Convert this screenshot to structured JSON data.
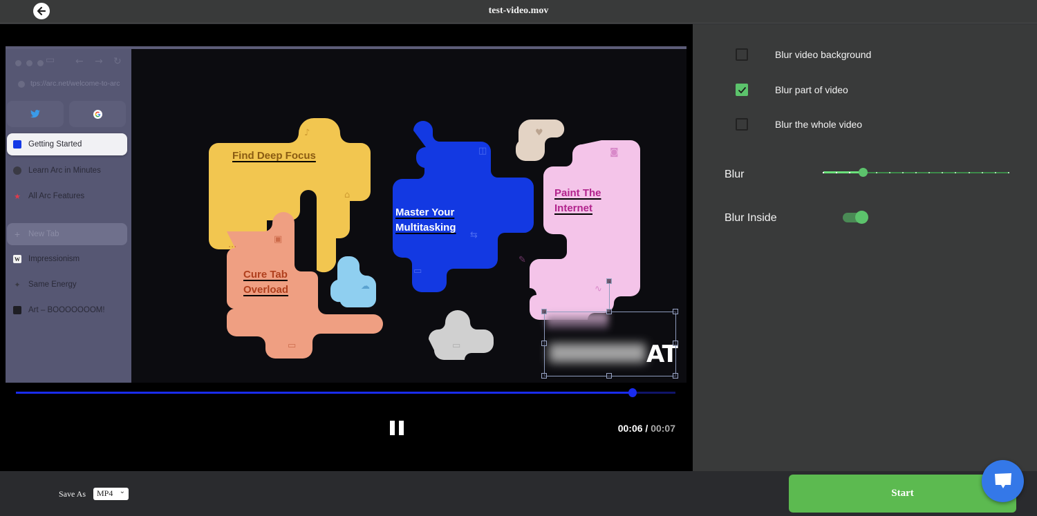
{
  "header": {
    "title": "test-video.mov",
    "back_icon": "arrow-left-circle-icon"
  },
  "video": {
    "browser_sidebar": {
      "url": "tps://arc.net/welcome-to-arc",
      "favorites": [
        "twitter",
        "google"
      ],
      "items": [
        {
          "label": "Getting Started",
          "icon": "blue-square",
          "active": true
        },
        {
          "label": "Learn Arc in Minutes",
          "icon": "person"
        },
        {
          "label": "All Arc Features",
          "icon": "star"
        },
        {
          "label": "New Tab",
          "icon": "plus",
          "placeholder": true
        },
        {
          "label": "Impressionism",
          "icon": "wikipedia"
        },
        {
          "label": "Same Energy",
          "icon": "sparkle"
        },
        {
          "label": "Art – BOOOOOOOM!",
          "icon": "grid"
        }
      ]
    },
    "tiles": [
      {
        "label_line1": "Find Deep Focus",
        "label_line2": "",
        "color": "#f5c84f",
        "text_color": "#8a5b12"
      },
      {
        "label_line1": "Master Your",
        "label_line2": "Multitasking",
        "color": "#1439e6",
        "text_color": "#ffffff"
      },
      {
        "label_line1": "Paint The",
        "label_line2": "Internet",
        "color": "#f5c6ea",
        "text_color": "#b2248d"
      },
      {
        "label_line1": "Cure Tab",
        "label_line2": "Overload",
        "color": "#f0a080",
        "text_color": "#b0401e"
      }
    ],
    "overlay_text": "AT"
  },
  "player": {
    "current_time": "00:06",
    "separator": "/",
    "duration": "00:07",
    "progress_fraction": 0.935,
    "state": "playing",
    "pause_icon": "pause-icon"
  },
  "settings": {
    "options": [
      {
        "label": "Blur video background",
        "checked": false
      },
      {
        "label": "Blur part of video",
        "checked": true
      },
      {
        "label": "Blur the whole video",
        "checked": false
      }
    ],
    "blur_label": "Blur",
    "blur_value": 3,
    "blur_max": 14,
    "blur_inside_label": "Blur Inside",
    "blur_inside_on": true,
    "accent_color": "#5cc36c"
  },
  "footer": {
    "save_as_label": "Save As",
    "format_value": "MP4",
    "start_label": "Start",
    "chat_icon": "chat-bubble-icon"
  }
}
